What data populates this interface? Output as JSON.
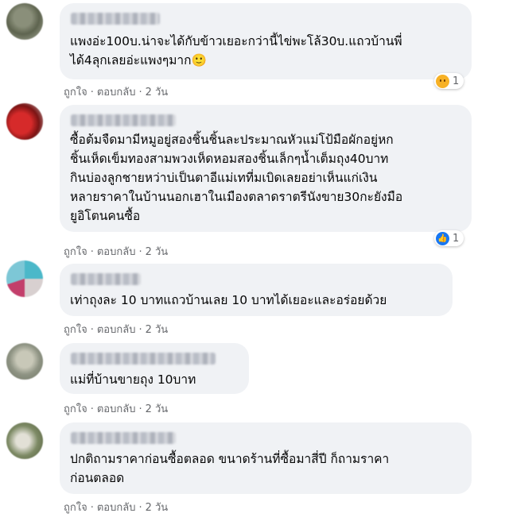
{
  "comments": [
    {
      "text": "แพงอ่ะ100บ.น่าจะได้กับข้าวเยอะกว่านี้ไข่พะโล้30บ.แถวบ้านพี่\nได้4ลุกเลยอ่ะแพงๆมาก🙂",
      "actions": {
        "like": "ถูกใจ",
        "reply": "ตอบกลับ",
        "time": "2 วัน"
      },
      "reaction": {
        "icon": "sad-reaction-icon",
        "count": "1"
      }
    },
    {
      "text": "ซื้อต้มจืดมามีหมูอยู่สองชิ้นชิ้นละประมาณหัวแม่โป้มือผักอยู่หก\nชิ้นเห็ดเข็มทองสามพวงเห็ดหอมสองชิ้นเล็กๆน้ำเต็มถุง40บาท\nกินบ่องลูกชายหว่าบ่เป็นตาอีแม่เทที่มเบิดเลยอย่าเห็นแก่เงิน\nหลายราคาในบ้านนอกเฮาในเมืองตลาดราตรีนังขาย30กะยังมือ\nยูอิโตนคนซื้อ",
      "actions": {
        "like": "ถูกใจ",
        "reply": "ตอบกลับ",
        "time": "2 วัน"
      },
      "reaction": {
        "icon": "like-reaction-icon",
        "count": "1"
      }
    },
    {
      "text": "เท่าถุงละ 10 บาทแถวบ้านเลย 10 บาทได้เยอะและอร่อยด้วย",
      "actions": {
        "like": "ถูกใจ",
        "reply": "ตอบกลับ",
        "time": "2 วัน"
      }
    },
    {
      "text": "แม่ที่บ้านขายถุง 10บาท",
      "actions": {
        "like": "ถูกใจ",
        "reply": "ตอบกลับ",
        "time": "2 วัน"
      }
    },
    {
      "text": "ปกติถามราคาก่อนซื้อตลอด ขนาดร้านที่ซื้อมาสี่ปี ก็ถามราคา\nก่อนตลอด",
      "actions": {
        "like": "ถูกใจ",
        "reply": "ตอบกลับ",
        "time": "2 วัน"
      }
    }
  ],
  "separator": "·",
  "colors": {
    "bubble": "#f0f2f5",
    "meta": "#65676b",
    "like_blue": "#1877f2",
    "sad_yellow": "#f7b125"
  }
}
